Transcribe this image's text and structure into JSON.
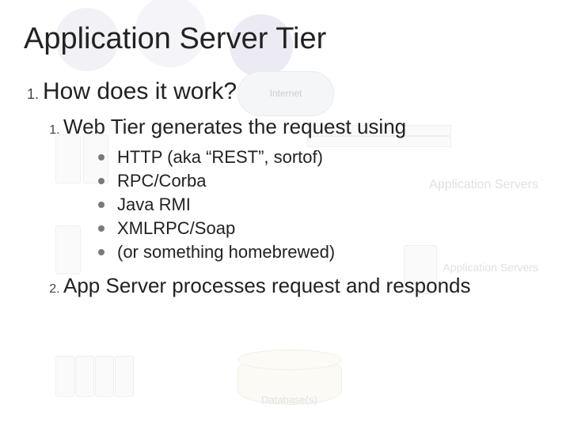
{
  "title": "Application Server Tier",
  "bg": {
    "cloud": "Internet",
    "app_servers": "Application\nServers",
    "app_servers2": "Application\nServers",
    "databases": "Database(s)"
  },
  "outline": {
    "item1": {
      "text": "How does it work?",
      "sub1": {
        "text": "Web Tier generates the request using",
        "bullets": [
          "HTTP (aka “REST”, sortof)",
          "RPC/Corba",
          "Java RMI",
          "XMLRPC/Soap",
          "(or something homebrewed)"
        ]
      },
      "sub2": {
        "text": "App Server processes request and responds"
      }
    }
  }
}
